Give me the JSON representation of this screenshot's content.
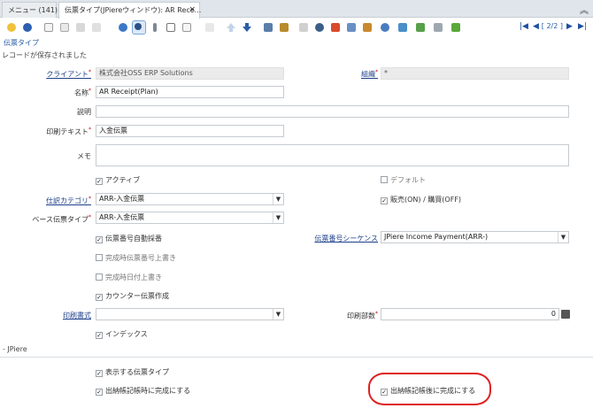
{
  "tabs": {
    "menu": "メニュー (141)",
    "window": "伝票タイプ(JPiereウィンドウ): AR Rece...",
    "close": "×"
  },
  "collapse_glyph": "︽",
  "toolbar": {
    "record_info": "[ 2/2 ]",
    "icons": [
      "undo-icon",
      "help-icon",
      "new-icon",
      "copy-icon",
      "save-icon",
      "delete-icon",
      "refresh-icon",
      "find-icon",
      "attachment-icon",
      "chat-icon",
      "grid-toggle-icon",
      "parent-icon",
      "previous-record-icon",
      "next-record-icon",
      "history-icon",
      "report-icon",
      "print-icon",
      "zoom-across-icon",
      "archive-icon",
      "product-info-icon",
      "workflow-icon",
      "process-icon",
      "request-icon",
      "export-icon",
      "lock-icon"
    ],
    "first": "|◀",
    "prev": "◀",
    "next": "▶",
    "last": "▶|"
  },
  "section_title": "伝票タイプ",
  "status_message": "レコードが保存されました",
  "fields": {
    "client_label": "クライアント",
    "client_value": "株式会社OSS ERP Solutions",
    "org_label": "組織",
    "org_value": "*",
    "name_label": "名称",
    "name_value": "AR Receipt(Plan)",
    "description_label": "説明",
    "description_value": "",
    "print_text_label": "印刷テキスト",
    "print_text_value": "入金伝票",
    "memo_label": "メモ",
    "memo_value": "",
    "active_label": "アクティブ",
    "default_label": "デフォルト",
    "gl_category_label": "仕訳カテゴリ",
    "gl_category_value": "ARR-入金伝票",
    "sotrx_label": "販売(ON) / 購買(OFF)",
    "base_doctype_label": "ベース伝票タイプ",
    "base_doctype_value": "ARR-入金伝票",
    "doc_no_controlled_label": "伝票番号自動採番",
    "doc_sequence_label": "伝票番号シーケンス",
    "doc_sequence_value": "JPiere Income Payment(ARR-)",
    "overwrite_seq_label": "完成時伝票番号上書き",
    "overwrite_date_label": "完成時日付上書き",
    "counter_doc_label": "カウンター伝票作成",
    "print_format_label": "印刷書式",
    "print_format_value": "",
    "document_copies_label": "印刷部数",
    "document_copies_value": "0",
    "indexed_label": "インデックス",
    "group_label": "- JPiere",
    "show_doctype_label": "表示する伝票タイプ",
    "complete_on_shipment_label": "出納帳記帳時に完成にする",
    "complete_after_shipment_label": "出納帳記帳後に完成にする"
  },
  "checkmark": "✓",
  "dropdown_glyph": "▼",
  "colors": {
    "link": "#1d3f8a",
    "highlight_ring": "#e02020",
    "accent": "#2a5ea8"
  }
}
